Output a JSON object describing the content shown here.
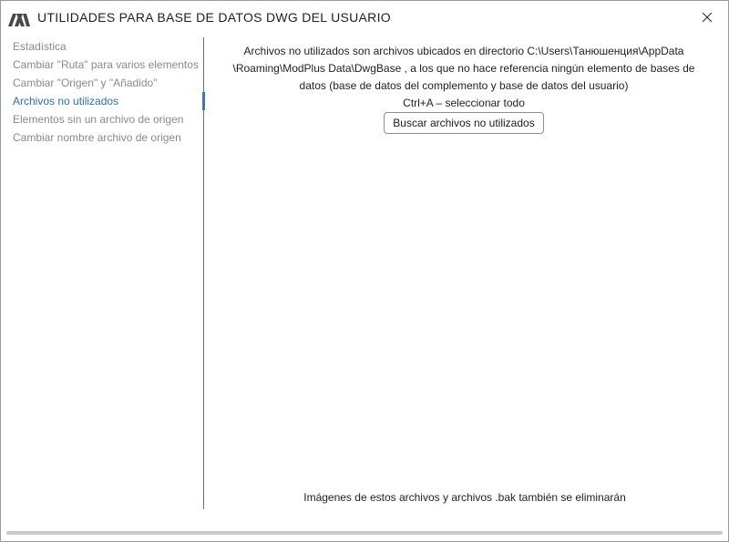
{
  "window": {
    "title": "UTILIDADES PARA BASE DE DATOS DWG DEL USUARIO",
    "logo_icon": "modplus-logo-icon",
    "close_icon": "close-icon"
  },
  "sidebar": {
    "items": [
      {
        "label": "Estadística",
        "active": false
      },
      {
        "label": "Cambiar \"Ruta\" para varios elementos",
        "active": false
      },
      {
        "label": "Cambiar \"Origen\" y \"Añadido\"",
        "active": false
      },
      {
        "label": "Archivos no utilizados",
        "active": true
      },
      {
        "label": "Elementos sin un archivo de origen",
        "active": false
      },
      {
        "label": "Cambiar nombre archivo de origen",
        "active": false
      }
    ]
  },
  "main": {
    "description_lines": [
      "Archivos no utilizados son archivos ubicados en directorio C:\\Users\\Танюшенция\\AppData",
      "\\Roaming\\ModPlus Data\\DwgBase , a los que no hace referencia ningún elemento de bases de",
      "datos (base de datos del complemento y base de datos del usuario)",
      "Ctrl+A – seleccionar todo"
    ],
    "search_button_label": "Buscar archivos no utilizados",
    "footer_note": "Imágenes de estos archivos y archivos .bak también se eliminarán"
  },
  "colors": {
    "accent": "#2d7bc8",
    "active_text": "#2d6fb3",
    "inactive_text": "#8a8a8a",
    "logo": "#4a4a4a"
  }
}
